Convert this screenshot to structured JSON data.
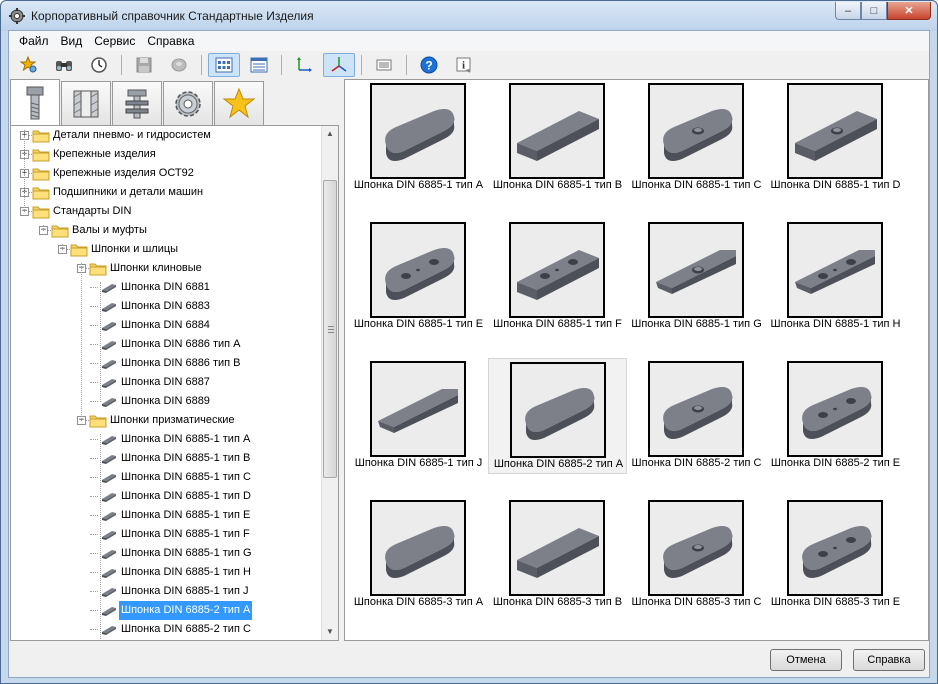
{
  "window": {
    "title": "Корпоративный справочник Стандартные Изделия",
    "minimize": "–",
    "maximize": "□",
    "close": "✕"
  },
  "menu": [
    "Файл",
    "Вид",
    "Сервис",
    "Справка"
  ],
  "toolbar": {
    "buttons": [
      "star-search-icon",
      "binoculars-icon",
      "clock-icon",
      "save-icon",
      "disk-icon",
      "grid-view-icon",
      "list-view-icon",
      "axis-2d-icon",
      "axis-3d-icon",
      "properties-icon",
      "help-icon",
      "info-icon"
    ]
  },
  "tabs": [
    "bolt-icon",
    "nut-section-icon",
    "fasteners-icon",
    "gear-icon",
    "favorites-star-icon"
  ],
  "tree": [
    {
      "label": "Детали пневмо- и гидросистем",
      "level": 0,
      "type": "folder",
      "expander": "+"
    },
    {
      "label": "Крепежные изделия",
      "level": 0,
      "type": "folder",
      "expander": "+"
    },
    {
      "label": "Крепежные изделия ОСТ92",
      "level": 0,
      "type": "folder",
      "expander": "+"
    },
    {
      "label": "Подшипники и детали машин",
      "level": 0,
      "type": "folder",
      "expander": "+"
    },
    {
      "label": "Стандарты DIN",
      "level": 0,
      "type": "folder",
      "expander": "−"
    },
    {
      "label": "Валы и муфты",
      "level": 1,
      "type": "folder",
      "expander": "−"
    },
    {
      "label": "Шпонки и шлицы",
      "level": 2,
      "type": "folder",
      "expander": "−"
    },
    {
      "label": "Шпонки клиновые",
      "level": 3,
      "type": "folder",
      "expander": "−"
    },
    {
      "label": "Шпонка DIN 6881",
      "level": 4,
      "type": "item"
    },
    {
      "label": "Шпонка DIN 6883",
      "level": 4,
      "type": "item"
    },
    {
      "label": "Шпонка DIN 6884",
      "level": 4,
      "type": "item"
    },
    {
      "label": "Шпонка DIN 6886 тип A",
      "level": 4,
      "type": "item"
    },
    {
      "label": "Шпонка DIN 6886 тип B",
      "level": 4,
      "type": "item"
    },
    {
      "label": "Шпонка DIN 6887",
      "level": 4,
      "type": "item"
    },
    {
      "label": "Шпонка DIN 6889",
      "level": 4,
      "type": "item"
    },
    {
      "label": "Шпонки призматические",
      "level": 3,
      "type": "folder",
      "expander": "−"
    },
    {
      "label": "Шпонка DIN 6885-1 тип A",
      "level": 4,
      "type": "item"
    },
    {
      "label": "Шпонка DIN 6885-1 тип B",
      "level": 4,
      "type": "item"
    },
    {
      "label": "Шпонка DIN 6885-1 тип C",
      "level": 4,
      "type": "item"
    },
    {
      "label": "Шпонка DIN 6885-1 тип D",
      "level": 4,
      "type": "item"
    },
    {
      "label": "Шпонка DIN 6885-1 тип E",
      "level": 4,
      "type": "item"
    },
    {
      "label": "Шпонка DIN 6885-1 тип F",
      "level": 4,
      "type": "item"
    },
    {
      "label": "Шпонка DIN 6885-1 тип G",
      "level": 4,
      "type": "item"
    },
    {
      "label": "Шпонка DIN 6885-1 тип H",
      "level": 4,
      "type": "item"
    },
    {
      "label": "Шпонка DIN 6885-1 тип J",
      "level": 4,
      "type": "item"
    },
    {
      "label": "Шпонка DIN 6885-2 тип A",
      "level": 4,
      "type": "item",
      "selected": true
    },
    {
      "label": "Шпонка DIN 6885-2 тип C",
      "level": 4,
      "type": "item"
    }
  ],
  "gallery": [
    {
      "caption": "Шпонка DIN 6885-1 тип A",
      "shape": "rounded"
    },
    {
      "caption": "Шпонка DIN 6885-1 тип B",
      "shape": "square"
    },
    {
      "caption": "Шпонка DIN 6885-1 тип C",
      "shape": "rounded-hole"
    },
    {
      "caption": "Шпонка DIN 6885-1 тип D",
      "shape": "square-hole"
    },
    {
      "caption": "Шпонка DIN 6885-1 тип E",
      "shape": "rounded-2holes"
    },
    {
      "caption": "Шпонка DIN 6885-1 тип F",
      "shape": "square-2holes"
    },
    {
      "caption": "Шпонка DIN 6885-1 тип G",
      "shape": "chamfer-hole"
    },
    {
      "caption": "Шпонка DIN 6885-1 тип H",
      "shape": "chamfer-2holes"
    },
    {
      "caption": "Шпонка DIN 6885-1 тип J",
      "shape": "chamfer"
    },
    {
      "caption": "Шпонка DIN 6885-2 тип A",
      "shape": "rounded",
      "selected": true
    },
    {
      "caption": "Шпонка DIN 6885-2 тип C",
      "shape": "rounded-hole"
    },
    {
      "caption": "Шпонка DIN 6885-2 тип E",
      "shape": "rounded-2holes"
    },
    {
      "caption": "Шпонка DIN 6885-3 тип A",
      "shape": "rounded"
    },
    {
      "caption": "Шпонка DIN 6885-3 тип B",
      "shape": "square"
    },
    {
      "caption": "Шпонка DIN 6885-3 тип C",
      "shape": "rounded-hole"
    },
    {
      "caption": "Шпонка DIN 6885-3 тип E",
      "shape": "rounded-2holes"
    }
  ],
  "buttons": {
    "cancel": "Отмена",
    "help": "Справка"
  }
}
